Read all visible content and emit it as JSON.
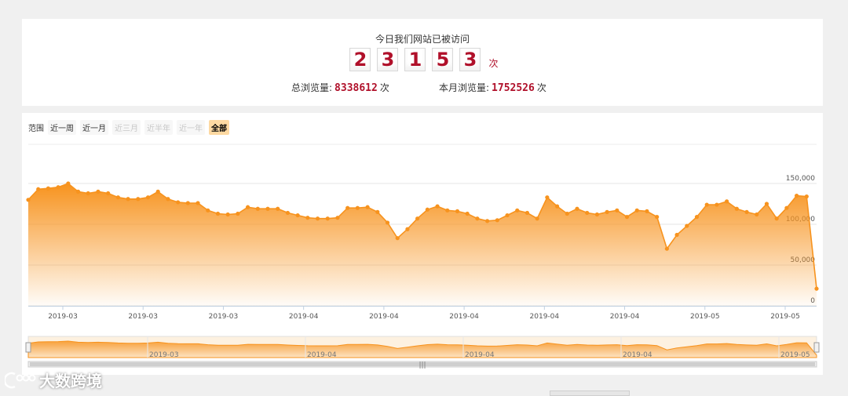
{
  "counter": {
    "title": "今日我们网站已被访问",
    "digits": [
      "2",
      "3",
      "1",
      "5",
      "3"
    ],
    "unit": "次"
  },
  "totals": {
    "total_label": "总浏览量:",
    "total_value": "8338612",
    "total_unit": "次",
    "month_label": "本月浏览量:",
    "month_value": "1752526",
    "month_unit": "次"
  },
  "range_selector": {
    "label": "范围",
    "buttons": [
      {
        "label": "近一周",
        "state": "normal"
      },
      {
        "label": "近一月",
        "state": "normal"
      },
      {
        "label": "近三月",
        "state": "disabled"
      },
      {
        "label": "近半年",
        "state": "disabled"
      },
      {
        "label": "近一年",
        "state": "disabled"
      },
      {
        "label": "全部",
        "state": "selected"
      }
    ]
  },
  "watermark": {
    "text": "大数跨境"
  },
  "colors": {
    "accent": "#f7931e",
    "counter_red": "#b0102a",
    "selected_bg": "#fdd9a2"
  },
  "chart_data": {
    "type": "area",
    "y_ticks": [
      0,
      50000,
      100000,
      150000
    ],
    "y_tick_labels": [
      "0",
      "50,000",
      "100,000",
      "150,000"
    ],
    "ylim": [
      0,
      150000
    ],
    "x_tick_labels": [
      "2019-03",
      "2019-03",
      "2019-03",
      "2019-04",
      "2019-04",
      "2019-04",
      "2019-04",
      "2019-04",
      "2019-05",
      "2019-05"
    ],
    "navigator_labels": [
      "2019-03",
      "2019-04",
      "2019-04",
      "2019-04",
      "2019-05"
    ],
    "grid": true,
    "series": [
      {
        "values": [
          130000,
          143000,
          144000,
          145500,
          150000,
          140000,
          138000,
          140000,
          138000,
          133000,
          131000,
          131000,
          133000,
          140000,
          131000,
          127000,
          126000,
          126000,
          117000,
          113000,
          112000,
          113000,
          121000,
          119000,
          119000,
          119000,
          114000,
          111000,
          108000,
          107000,
          107000,
          108000,
          120000,
          120000,
          121000,
          115000,
          102000,
          83000,
          94000,
          107000,
          118000,
          122000,
          117000,
          116000,
          113000,
          107000,
          104000,
          105000,
          111000,
          117000,
          114000,
          107000,
          133000,
          122000,
          113000,
          119000,
          114000,
          112000,
          115000,
          117000,
          109000,
          117000,
          116000,
          109000,
          70000,
          87000,
          98000,
          109000,
          124000,
          124000,
          128000,
          119000,
          115000,
          112000,
          125000,
          107000,
          120000,
          135000,
          134000,
          21000
        ]
      }
    ]
  }
}
